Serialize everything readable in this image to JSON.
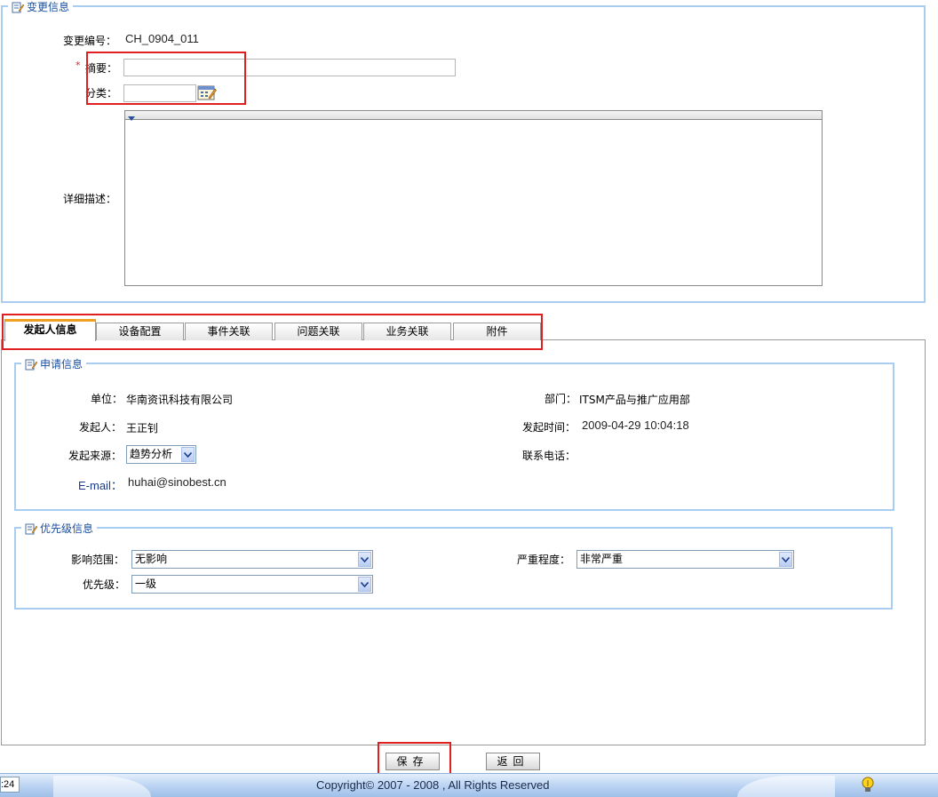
{
  "change_info": {
    "section_title": "变更信息",
    "number_label": "变更编号：",
    "number_value": "CH_0904_011",
    "required_mark": "*",
    "summary_label": "摘要：",
    "summary_value": "",
    "category_label": "分类：",
    "category_value": "",
    "detail_label": "详细描述："
  },
  "tabs": [
    {
      "label": "发起人信息",
      "active": true
    },
    {
      "label": "设备配置"
    },
    {
      "label": "事件关联"
    },
    {
      "label": "问题关联"
    },
    {
      "label": "业务关联"
    },
    {
      "label": "附件"
    }
  ],
  "apply_info": {
    "section_title": "申请信息",
    "unit_label": "单位：",
    "unit_value": "华南资讯科技有限公司",
    "dept_label": "部门：",
    "dept_value": "ITSM产品与推广应用部",
    "initiator_label": "发起人：",
    "initiator_value": "王正钊",
    "time_label": "发起时间：",
    "time_value": "2009-04-29 10:04:18",
    "source_label": "发起来源：",
    "source_value": "趋势分析",
    "phone_label": "联系电话：",
    "phone_value": "",
    "email_label": "E-mail：",
    "email_value": "huhai@sinobest.cn"
  },
  "priority_info": {
    "section_title": "优先级信息",
    "impact_label": "影响范围：",
    "impact_value": "无影响",
    "severity_label": "严重程度：",
    "severity_value": "非常严重",
    "priority_label": "优先级：",
    "priority_value": "一级"
  },
  "buttons": {
    "save": "保存",
    "back": "返回"
  },
  "footer": {
    "time_fragment": ":24",
    "copyright": "Copyright© 2007 - 2008 , All Rights Reserved"
  },
  "colors": {
    "fieldset_border": "#a9cdf0",
    "title_blue": "#1a4fa0",
    "highlight_red": "#e02020",
    "email_label": "#1a3a8a"
  }
}
